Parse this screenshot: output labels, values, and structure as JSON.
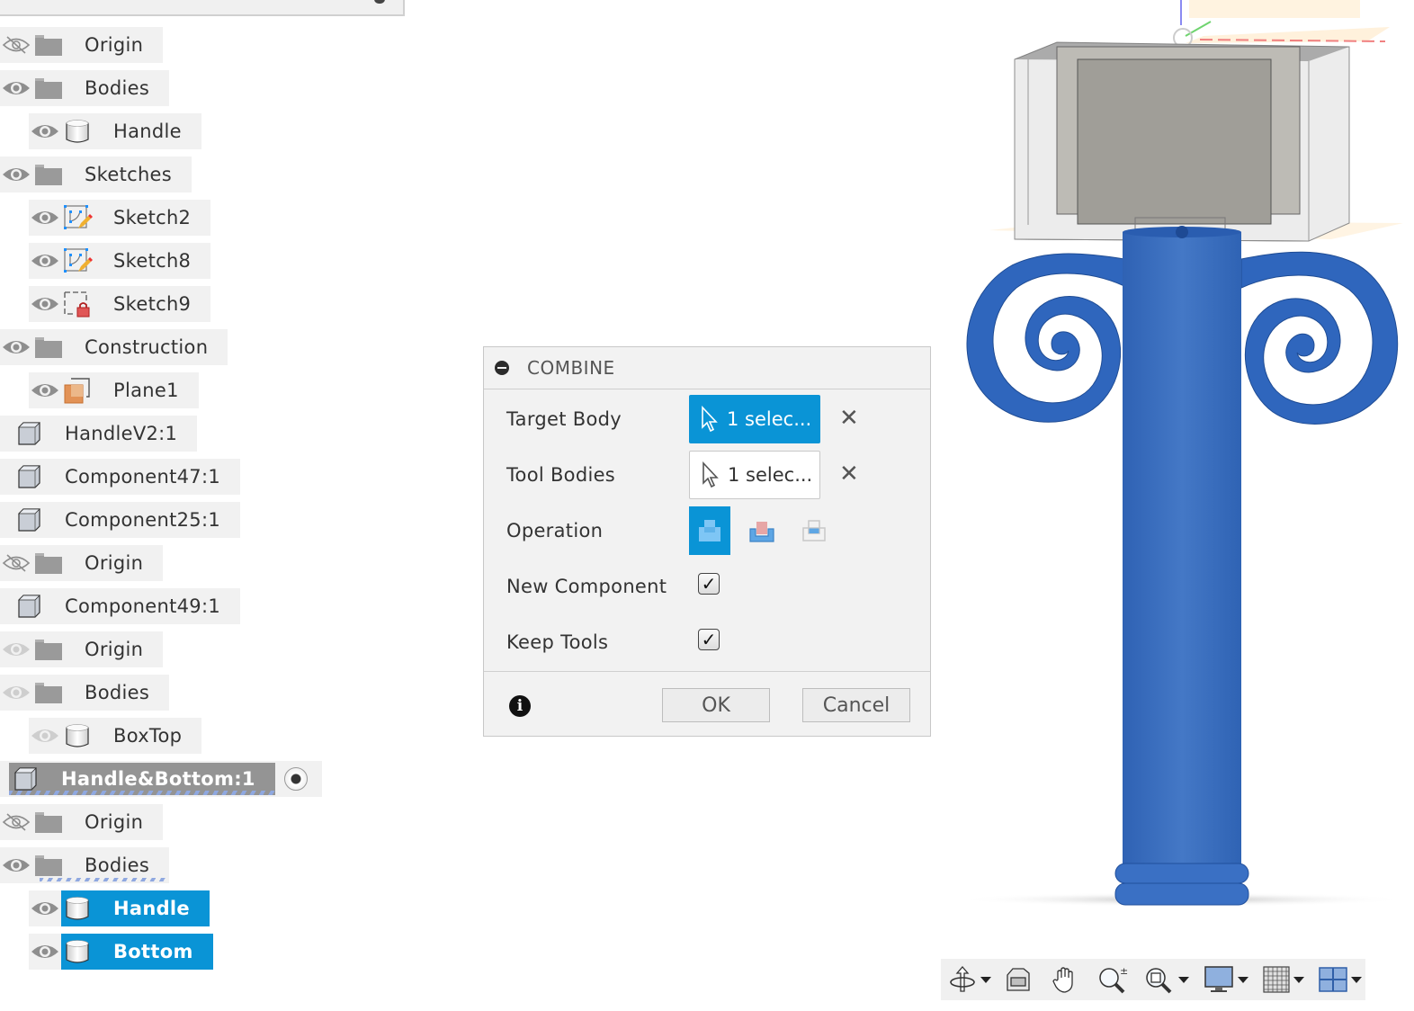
{
  "browser": {
    "rows": [
      {
        "label": "Origin",
        "indent": 0,
        "visibility": "hidden",
        "icon": "folder-icon"
      },
      {
        "label": "Bodies",
        "indent": 0,
        "visibility": "visible",
        "icon": "folder-icon"
      },
      {
        "label": "Handle",
        "indent": 1,
        "visibility": "visible",
        "icon": "body-icon"
      },
      {
        "label": "Sketches",
        "indent": 0,
        "visibility": "visible",
        "icon": "folder-icon"
      },
      {
        "label": "Sketch2",
        "indent": 1,
        "visibility": "visible",
        "icon": "sketch-icon"
      },
      {
        "label": "Sketch8",
        "indent": 1,
        "visibility": "visible",
        "icon": "sketch-icon"
      },
      {
        "label": "Sketch9",
        "indent": 1,
        "visibility": "visible",
        "icon": "sketch-locked-icon"
      },
      {
        "label": "Construction",
        "indent": 0,
        "visibility": "visible",
        "icon": "folder-icon"
      },
      {
        "label": "Plane1",
        "indent": 1,
        "visibility": "visible",
        "icon": "plane-icon"
      },
      {
        "label": "HandleV2:1",
        "indent": 0,
        "visibility": "none",
        "icon": "component-icon"
      },
      {
        "label": "Component47:1",
        "indent": 0,
        "visibility": "none",
        "icon": "component-icon"
      },
      {
        "label": "Component25:1",
        "indent": 0,
        "visibility": "none",
        "icon": "component-icon"
      },
      {
        "label": "Origin",
        "indent": 0,
        "visibility": "hidden",
        "icon": "folder-icon"
      },
      {
        "label": "Component49:1",
        "indent": 0,
        "visibility": "none",
        "icon": "component-icon"
      },
      {
        "label": "Origin",
        "indent": 0,
        "visibility": "dimmed",
        "icon": "folder-icon"
      },
      {
        "label": "Bodies",
        "indent": 0,
        "visibility": "dimmed",
        "icon": "folder-icon"
      },
      {
        "label": "BoxTop",
        "indent": 1,
        "visibility": "dimmed",
        "icon": "body-icon"
      },
      {
        "label": "Handle&Bottom:1",
        "indent": 0,
        "visibility": "none",
        "icon": "component-icon",
        "state": "active-component"
      },
      {
        "label": "Origin",
        "indent": 0,
        "visibility": "hidden",
        "icon": "folder-icon"
      },
      {
        "label": "Bodies",
        "indent": 0,
        "visibility": "visible",
        "icon": "folder-icon",
        "state": "hatched"
      },
      {
        "label": "Handle",
        "indent": 1,
        "visibility": "visible",
        "icon": "body-icon",
        "state": "selected"
      },
      {
        "label": "Bottom",
        "indent": 1,
        "visibility": "visible",
        "icon": "body-icon",
        "state": "selected"
      }
    ]
  },
  "dialog": {
    "title": "COMBINE",
    "target_body": {
      "label": "Target Body",
      "value": "1 selec..."
    },
    "tool_bodies": {
      "label": "Tool Bodies",
      "value": "1 selec..."
    },
    "operation": {
      "label": "Operation",
      "options": [
        "join",
        "cut",
        "intersect"
      ],
      "selected": "join"
    },
    "new_component": {
      "label": "New Component",
      "checked": true,
      "mark": "✓"
    },
    "keep_tools": {
      "label": "Keep Tools",
      "checked": true,
      "mark": "✓"
    },
    "ok_label": "OK",
    "cancel_label": "Cancel",
    "info_glyph": "i",
    "clear_glyph": "✕"
  },
  "colors": {
    "accent": "#0a94d6",
    "model_blue": "#3a6fc0",
    "selected_component": "#949494"
  },
  "navbar": {
    "tools": [
      "orbit-icon",
      "look-at-icon",
      "pan-icon",
      "zoom-icon",
      "fit-icon",
      "display-settings-icon",
      "grid-icon",
      "viewports-icon"
    ]
  }
}
